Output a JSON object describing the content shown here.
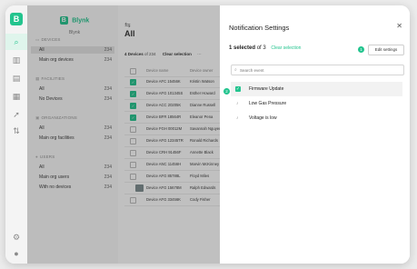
{
  "colors": {
    "accent": "#23c48e",
    "overlay": "rgba(30,30,30,0.28)"
  },
  "brand": {
    "logo_letter": "B",
    "name": "Blynk",
    "sub": "Blynk"
  },
  "sidebar": {
    "sections": [
      {
        "title": "DEVICES",
        "icon": "device-icon",
        "items": [
          {
            "label": "All",
            "count": "234",
            "selected": true
          },
          {
            "label": "Main org devices",
            "count": "234"
          }
        ]
      },
      {
        "title": "FACILITIES",
        "icon": "facility-icon",
        "items": [
          {
            "label": "All",
            "count": "234"
          },
          {
            "label": "No Devices",
            "count": "234"
          }
        ]
      },
      {
        "title": "ORGANIZATIONS",
        "icon": "organization-icon",
        "items": [
          {
            "label": "All",
            "count": "234"
          },
          {
            "label": "Main org facilities",
            "count": "234"
          }
        ]
      },
      {
        "title": "USERS",
        "icon": "users-icon",
        "items": [
          {
            "label": "All",
            "count": "234"
          },
          {
            "label": "Main org users",
            "count": "234"
          },
          {
            "label": "With no devices",
            "count": "234"
          }
        ]
      }
    ]
  },
  "main": {
    "title": "All",
    "toolbar": {
      "count_text": "4 Devices",
      "of_text": "of 234",
      "clear_label": "Clear selection",
      "more": "···"
    },
    "columns": [
      "Device name",
      "Device owner"
    ],
    "rows": [
      {
        "name": "Device AFC 15456K",
        "owner": "Kristin Watson",
        "checked": true
      },
      {
        "name": "Device AFG 101345S",
        "owner": "Esther Howard",
        "checked": true
      },
      {
        "name": "Device ACC 20205K",
        "owner": "Dianne Russell",
        "checked": true
      },
      {
        "name": "Device BFR 18564R",
        "owner": "Eleanor Pena",
        "checked": true
      },
      {
        "name": "Device FGH 00012M",
        "owner": "Savannah Nguyen",
        "checked": false
      },
      {
        "name": "Device AFG 12345TR",
        "owner": "Ronald Richards",
        "checked": false
      },
      {
        "name": "Device CRH 91456F",
        "owner": "Annette Black",
        "checked": false
      },
      {
        "name": "Device ANC 11456H",
        "owner": "Marvin McKinney",
        "checked": false
      },
      {
        "name": "Device AFG 85788L",
        "owner": "Floyd Miles",
        "checked": false
      },
      {
        "name": "Device AFG 15678M",
        "owner": "Ralph Edwards",
        "checked": false,
        "thumb": true
      },
      {
        "name": "Device AFG 33456K",
        "owner": "Cody Fisher",
        "checked": false
      }
    ]
  },
  "panel": {
    "title": "Notification Settings",
    "close_icon": "close-icon",
    "selected_bold": "1 selected",
    "selected_rest": "of 3",
    "clear_label": "Clear selection",
    "badge_edit": "1",
    "edit_label": "Edit settings",
    "search_placeholder": "Search event",
    "badge_row": "2",
    "events": [
      {
        "label": "Firmware Update",
        "checked": true
      },
      {
        "label": "Low Gas Pressure",
        "checked": false
      },
      {
        "label": "Voltage is low",
        "checked": false
      }
    ]
  }
}
